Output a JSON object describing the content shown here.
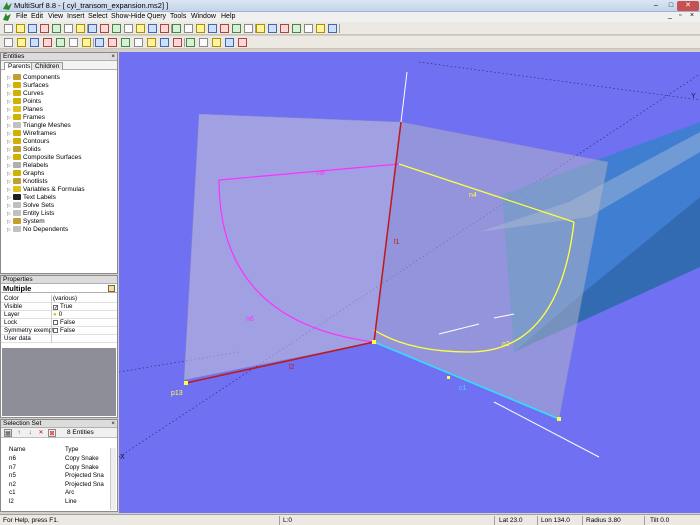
{
  "window": {
    "title": "MultiSurf 8.8 - [ cyl_transom_expansion.ms2] ]",
    "minimize": "–",
    "maximize": "□",
    "close": "✕"
  },
  "menubar": {
    "items": [
      "File",
      "Edit",
      "View",
      "Insert",
      "Select",
      "Show-Hide",
      "Query",
      "Tools",
      "Window",
      "Help"
    ],
    "mdi_minimize": "_",
    "mdi_restore": "▫",
    "mdi_close": "×"
  },
  "toolbar_icons": {
    "row1": [
      "new-file-icon",
      "open-folder-icon",
      "save-icon",
      "print-icon",
      "cut-icon",
      "copy-icon",
      "paste-icon",
      "undo-icon",
      "redo-icon",
      "point-icon",
      "bead-icon",
      "ring-icon",
      "magnet-icon",
      "curve-icon",
      "snake-icon",
      "surface-icon",
      "lightbulb-icon",
      "wireframe-icon",
      "view-icon",
      "render-icon",
      "select-arrow-icon",
      "zoom-icon",
      "rotate-icon",
      "pan-icon",
      "chart-icon",
      "grid-icon",
      "info-icon",
      "layers-icon"
    ],
    "row2": [
      "point-tool-icon",
      "bead-tool-icon",
      "line-tool-icon",
      "arc-tool-icon",
      "curve-tool-icon",
      "surface-tool-icon",
      "frame-tool-icon",
      "mesh-tool-icon",
      "contour-tool-icon",
      "solid-tool-icon",
      "graph-tool-icon",
      "knot-tool-icon",
      "label-tool-icon",
      "eye-icon",
      "eye-closed-icon",
      "snake-eye-icon",
      "move-icon",
      "home-view-icon",
      "orbit-icon"
    ]
  },
  "entities": {
    "header": "Entities",
    "tabs": [
      {
        "label": "Parents",
        "active": true
      },
      {
        "label": "Children",
        "active": false
      }
    ],
    "items": [
      {
        "label": "Components",
        "color": "#c0a030"
      },
      {
        "label": "Surfaces",
        "color": "#d0b000"
      },
      {
        "label": "Curves",
        "color": "#d0b000"
      },
      {
        "label": "Points",
        "color": "#d0b000"
      },
      {
        "label": "Planes",
        "color": "#e0c020"
      },
      {
        "label": "Frames",
        "color": "#d0b000"
      },
      {
        "label": "Triangle Meshes",
        "color": "#c0c0c0"
      },
      {
        "label": "Wireframes",
        "color": "#d0b000"
      },
      {
        "label": "Contours",
        "color": "#d0b000"
      },
      {
        "label": "Solids",
        "color": "#c0a030"
      },
      {
        "label": "Composite Surfaces",
        "color": "#d0b000"
      },
      {
        "label": "Relabels",
        "color": "#b0b0b0"
      },
      {
        "label": "Graphs",
        "color": "#d0b000"
      },
      {
        "label": "Knotlists",
        "color": "#c0a030"
      },
      {
        "label": "Variables & Formulas",
        "color": "#e0c020"
      },
      {
        "label": "Text Labels",
        "color": "#202020"
      },
      {
        "label": "Solve Sets",
        "color": "#c0c0c0"
      },
      {
        "label": "Entity Lists",
        "color": "#c0c0c0"
      },
      {
        "label": "System",
        "color": "#c0a030"
      },
      {
        "label": "No Dependents",
        "color": "#c0c0c0"
      }
    ]
  },
  "properties": {
    "header": "Properties",
    "title": "Multiple",
    "rows": [
      {
        "key": "Color",
        "value": "(various)"
      },
      {
        "key": "Visible",
        "value": "True",
        "check": "✓"
      },
      {
        "key": "Layer",
        "value": "0",
        "bulb": true
      },
      {
        "key": "Lock",
        "value": "False",
        "check": ""
      },
      {
        "key": "Symmetry exempt",
        "value": "False",
        "check": ""
      },
      {
        "key": "User data",
        "value": ""
      }
    ]
  },
  "selection": {
    "header": "Selection Set",
    "count": "8 Entities",
    "columns": [
      "Name",
      "Type"
    ],
    "rows": [
      {
        "name": "n6",
        "type": "Copy Snake"
      },
      {
        "name": "n7",
        "type": "Copy Snake"
      },
      {
        "name": "n5",
        "type": "Projected Sna"
      },
      {
        "name": "n2",
        "type": "Projected Sna"
      },
      {
        "name": "c1",
        "type": "Arc"
      },
      {
        "name": "l2",
        "type": "Line"
      }
    ]
  },
  "viewport": {
    "background": "#7070f2",
    "labels": {
      "n5": "n5",
      "n4": "n4",
      "l1": "l1",
      "n6": "n6",
      "n2": "n2",
      "l2": "l2",
      "p13": "p13",
      "c1": "c1",
      "axis_y": "Y",
      "axis_x": "X"
    },
    "colors": {
      "magenta_curve": "#ff30ff",
      "yellow_curve": "#ffff40",
      "red_line": "#c01818",
      "cyan_line": "#30e0ff",
      "teal_surface": "#1a8ab8"
    }
  },
  "status": {
    "help": "For Help, press F1.",
    "layer": "L:0",
    "lat": "Lat 23.0",
    "lon": "Lon 134.0",
    "radius": "Radius 3.80",
    "tilt": "Tilt 0.0"
  }
}
